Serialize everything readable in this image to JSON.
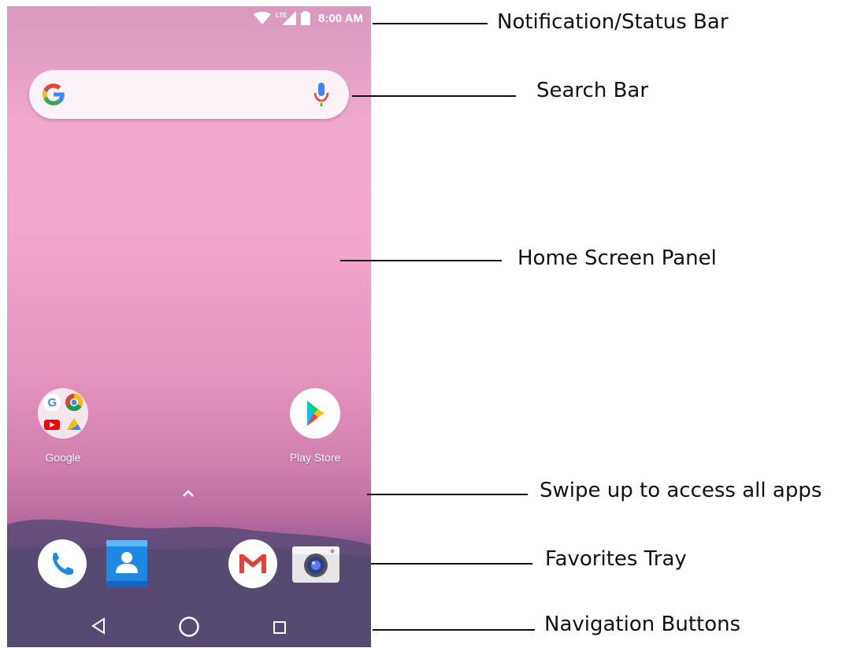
{
  "status_bar": {
    "time": "8:00 AM",
    "network": "LTE",
    "icons": [
      "wifi-icon",
      "signal-icon",
      "battery-icon"
    ]
  },
  "search_bar": {
    "icons": [
      "google-g-icon",
      "microphone-icon"
    ]
  },
  "home_apps": [
    {
      "label": "Google",
      "icon": "google-folder-icon"
    },
    {
      "label": "Play Store",
      "icon": "play-store-icon"
    }
  ],
  "favorites": [
    {
      "icon": "phone-icon"
    },
    {
      "icon": "contacts-icon"
    },
    {
      "icon": "gmail-icon"
    },
    {
      "icon": "camera-icon"
    }
  ],
  "navigation": {
    "icons": [
      "back-icon",
      "home-icon",
      "recents-icon"
    ]
  },
  "callouts": [
    {
      "label": "Notification/Status Bar"
    },
    {
      "label": "Search Bar"
    },
    {
      "label": "Home Screen Panel"
    },
    {
      "label": "Swipe up to access all apps"
    },
    {
      "label": "Favorites Tray"
    },
    {
      "label": "Navigation Buttons"
    }
  ],
  "colors": {
    "google_blue": "#4285F4",
    "google_red": "#EA4335",
    "google_yellow": "#FBBC05",
    "google_green": "#34A853",
    "phone_blue": "#1E88E5"
  }
}
